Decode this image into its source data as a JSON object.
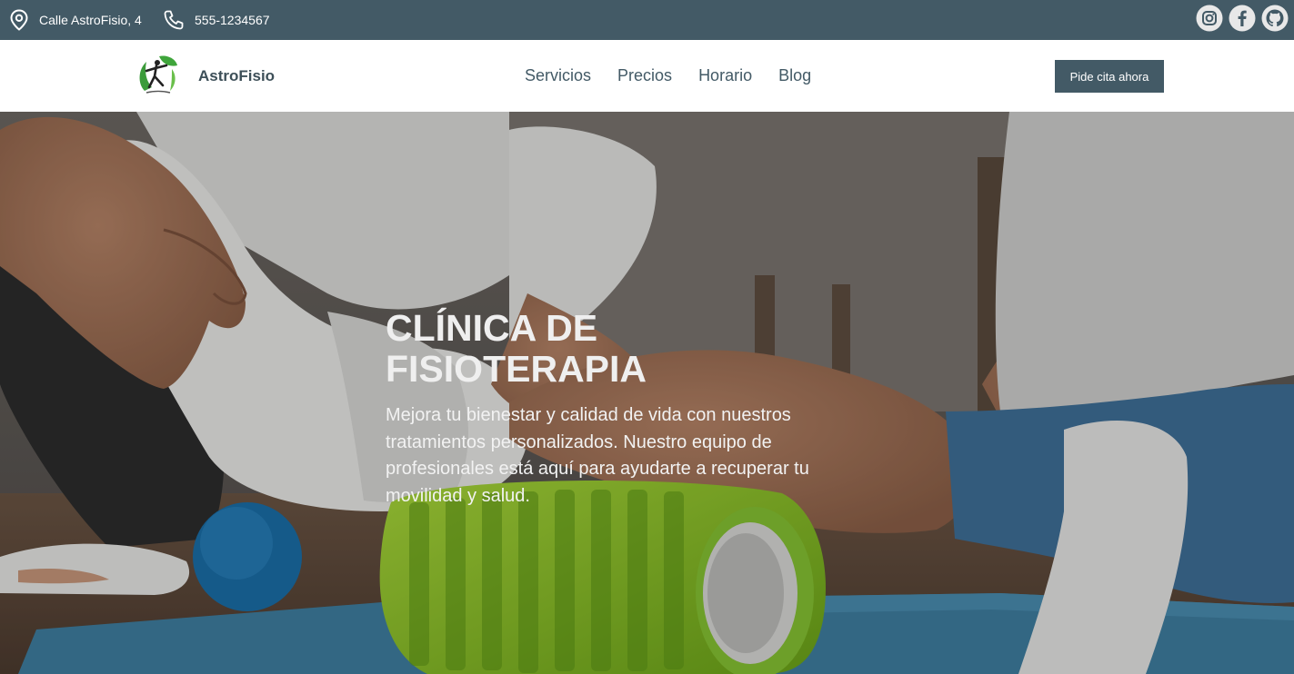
{
  "topbar": {
    "address": "Calle AstroFisio, 4",
    "phone": "555-1234567",
    "social": [
      {
        "icon": "instagram-icon"
      },
      {
        "icon": "facebook-icon"
      },
      {
        "icon": "github-icon"
      }
    ]
  },
  "nav": {
    "brand": "AstroFisio",
    "links": [
      "Servicios",
      "Precios",
      "Horario",
      "Blog"
    ],
    "cta": "Pide cita ahora"
  },
  "hero": {
    "title_line1": "CLÍNICA DE",
    "title_line2": "FISIOTERAPIA",
    "description": "Mejora tu bienestar y calidad de vida con nuestros tratamientos personalizados. Nuestro equipo de profesionales está aquí para ayudarte a recuperar tu movilidad y salud."
  },
  "colors": {
    "primary": "#435a66",
    "background": "#ffffff",
    "text_on_primary": "#ffffff"
  }
}
